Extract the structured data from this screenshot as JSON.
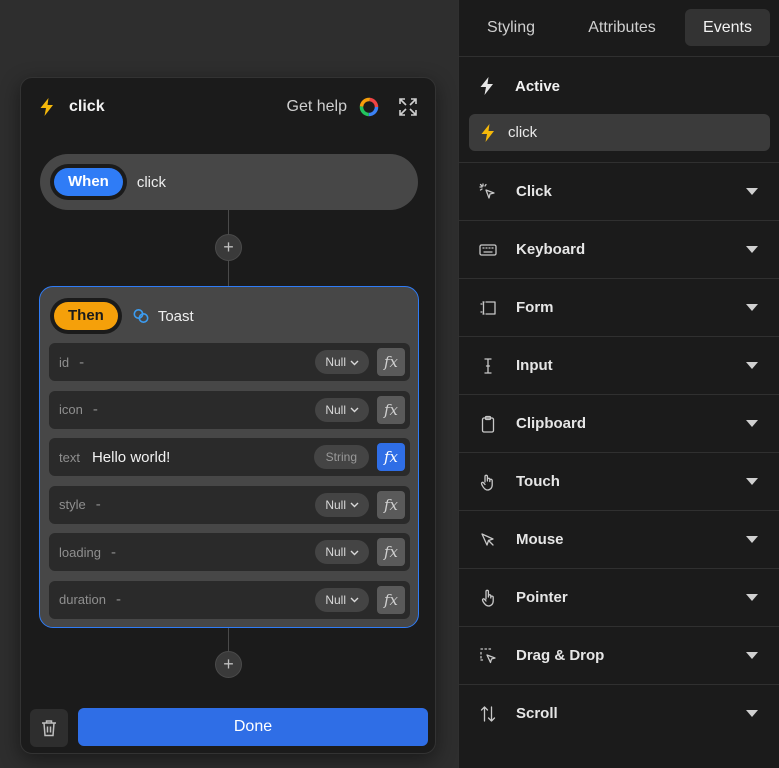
{
  "editor": {
    "title": "click",
    "help_label": "Get help",
    "when": {
      "label": "When",
      "event": "click"
    },
    "then": {
      "label": "Then",
      "action": "Toast",
      "params": [
        {
          "name": "id",
          "value": "-",
          "type": "Null",
          "filled": false
        },
        {
          "name": "icon",
          "value": "-",
          "type": "Null",
          "filled": false
        },
        {
          "name": "text",
          "value": "Hello world!",
          "type": "String",
          "filled": true
        },
        {
          "name": "style",
          "value": "-",
          "type": "Null",
          "filled": false
        },
        {
          "name": "loading",
          "value": "-",
          "type": "Null",
          "filled": false
        },
        {
          "name": "duration",
          "value": "-",
          "type": "Null",
          "filled": false
        }
      ]
    },
    "fx_label": "fx",
    "plus_label": "+",
    "done_label": "Done"
  },
  "sidebar": {
    "tabs": [
      "Styling",
      "Attributes",
      "Events"
    ],
    "active_tab": "Events",
    "active_header": "Active",
    "active_event": "click",
    "categories": [
      {
        "label": "Click",
        "icon": "pointer-burst-icon"
      },
      {
        "label": "Keyboard",
        "icon": "keyboard-icon"
      },
      {
        "label": "Form",
        "icon": "form-field-icon"
      },
      {
        "label": "Input",
        "icon": "text-cursor-icon"
      },
      {
        "label": "Clipboard",
        "icon": "clipboard-icon"
      },
      {
        "label": "Touch",
        "icon": "hand-icon"
      },
      {
        "label": "Mouse",
        "icon": "cursor-arrow-icon"
      },
      {
        "label": "Pointer",
        "icon": "hand-pointer-icon"
      },
      {
        "label": "Drag & Drop",
        "icon": "drag-drop-icon"
      },
      {
        "label": "Scroll",
        "icon": "scroll-arrows-icon"
      }
    ]
  },
  "colors": {
    "accent_blue": "#2f7cf6",
    "then_orange": "#f5a00a",
    "bolt_yellow": "#f5b80a",
    "panel_bg": "#1b1b1b",
    "block_bg": "#474747"
  }
}
